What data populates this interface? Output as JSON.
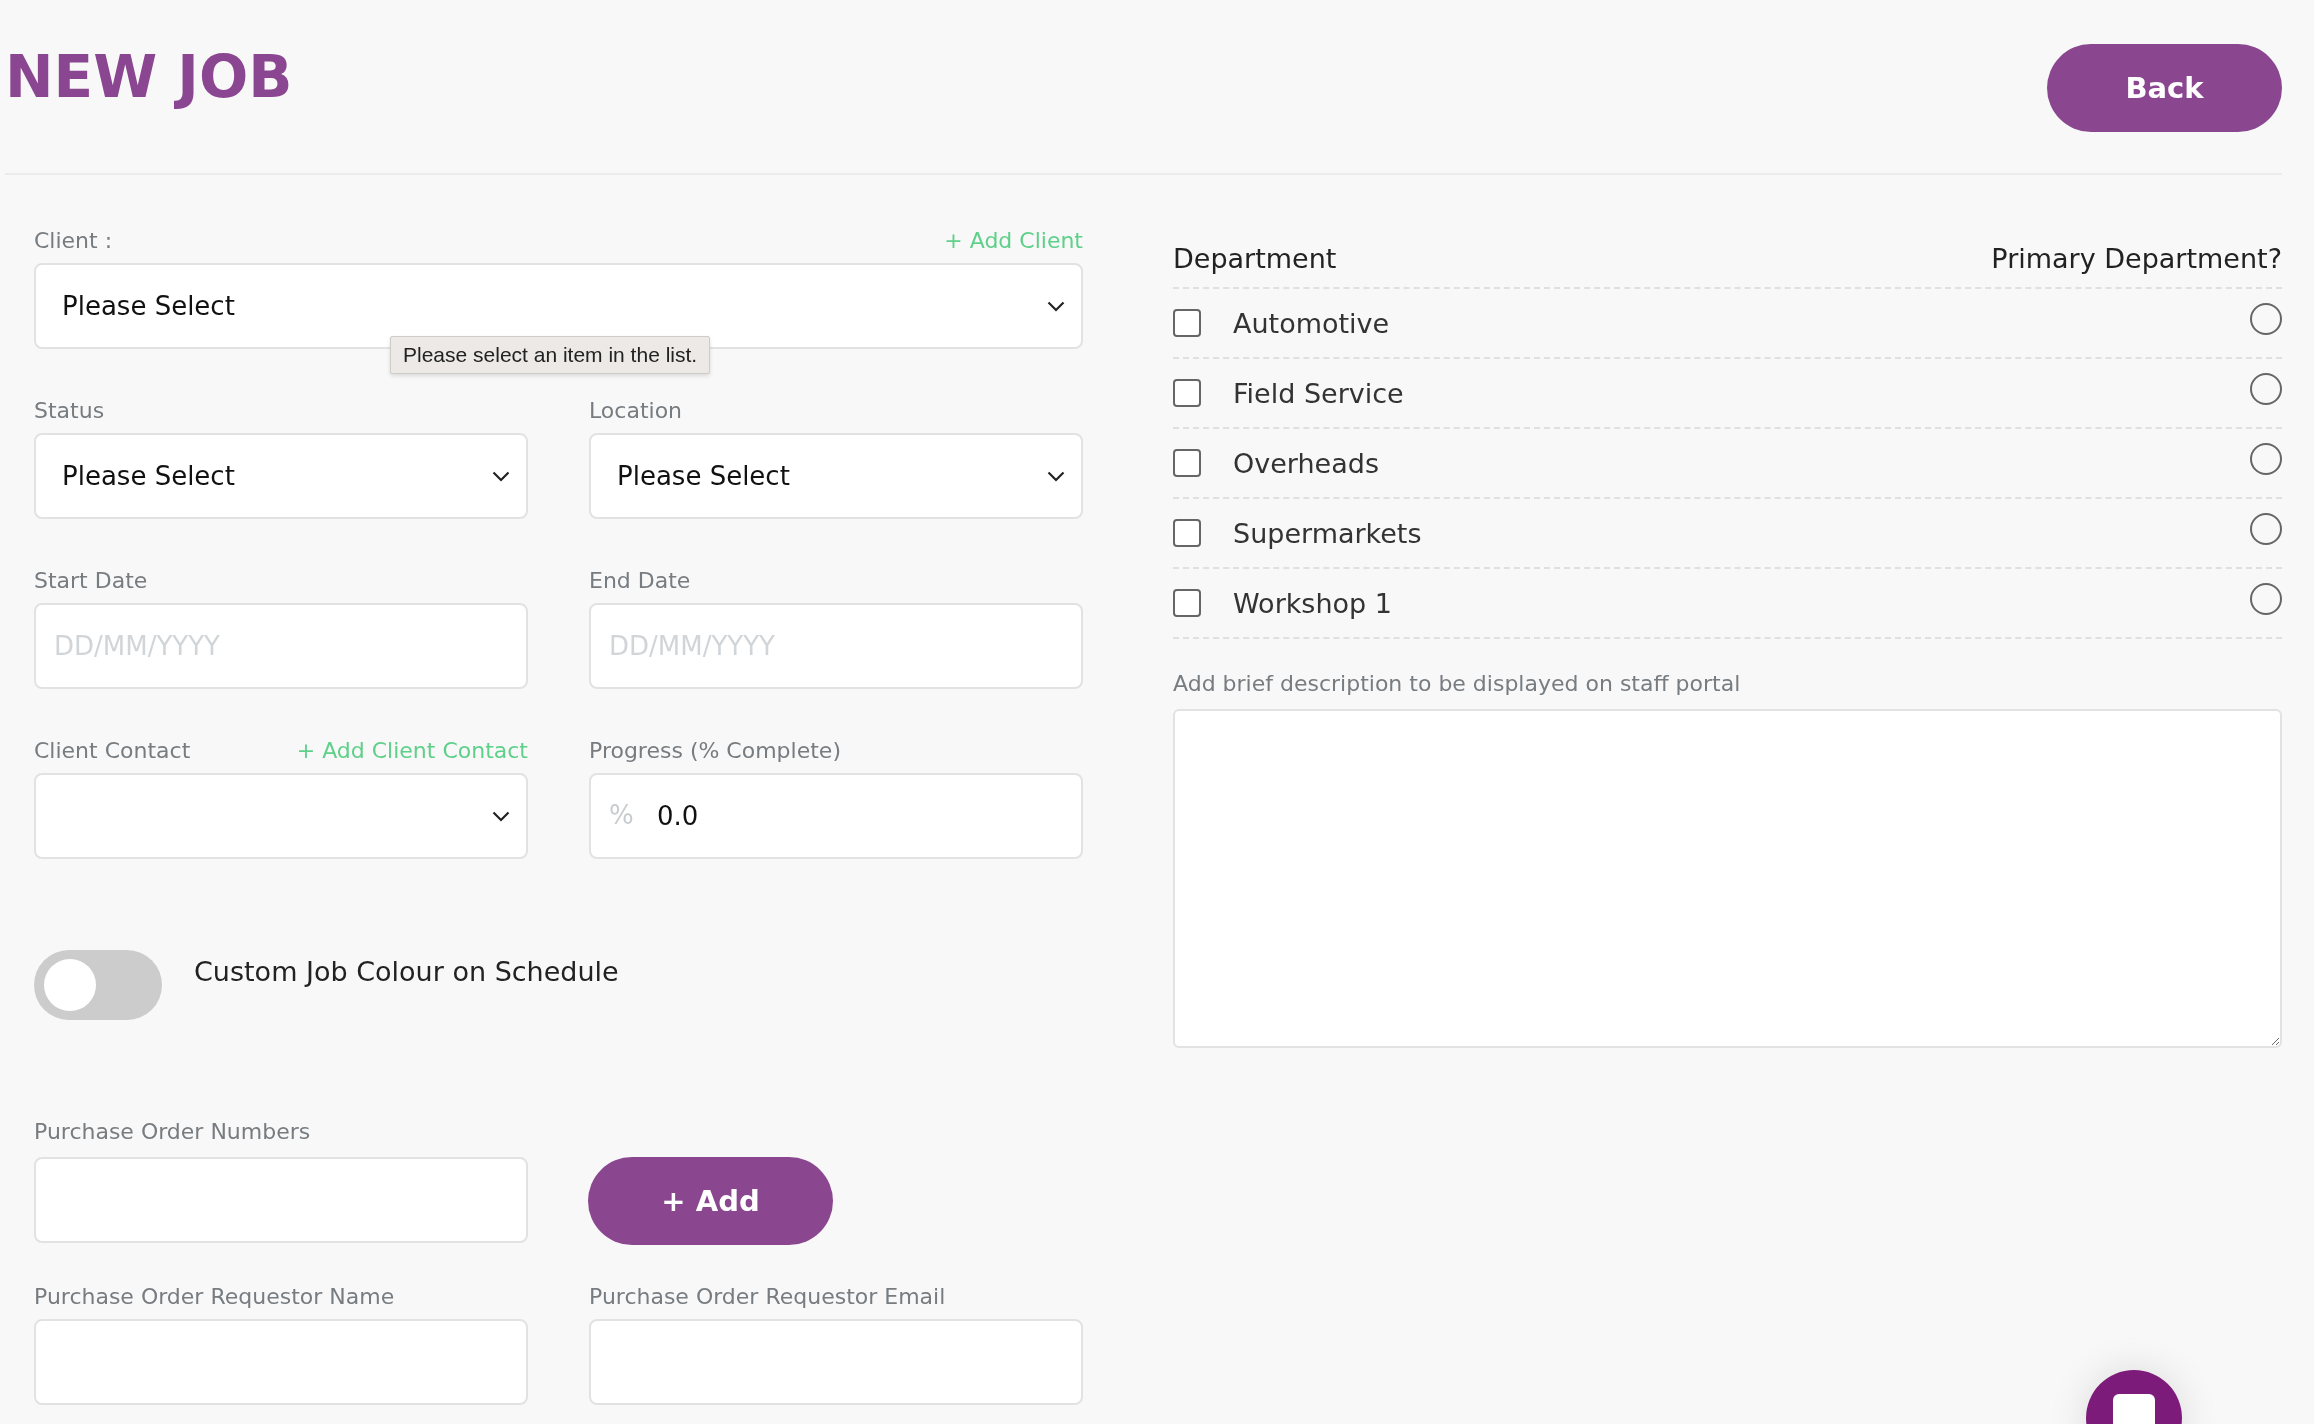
{
  "page": {
    "title": "NEW JOB",
    "back_button": "Back"
  },
  "client": {
    "label": "Client :",
    "add_link": "+ Add Client",
    "value": "Please Select",
    "tooltip": "Please select an item in the list."
  },
  "status": {
    "label": "Status",
    "value": "Please Select"
  },
  "location": {
    "label": "Location",
    "value": "Please Select"
  },
  "start_date": {
    "label": "Start Date",
    "placeholder": "DD/MM/YYYY"
  },
  "end_date": {
    "label": "End Date",
    "placeholder": "DD/MM/YYYY"
  },
  "client_contact": {
    "label": "Client Contact",
    "add_link": "+ Add Client Contact"
  },
  "progress": {
    "label": "Progress (% Complete)",
    "prefix": "%",
    "value": "0.0"
  },
  "custom_colour": {
    "label": "Custom Job Colour on Schedule",
    "on": false
  },
  "purchase_order_numbers": {
    "label": "Purchase Order Numbers",
    "add_button": "+ Add"
  },
  "requestor_name": {
    "label": "Purchase Order Requestor Name"
  },
  "requestor_email": {
    "label": "Purchase Order Requestor Email"
  },
  "departments": {
    "column_1": "Department",
    "column_2": "Primary Department?",
    "items": [
      {
        "name": "Automotive",
        "checked": false,
        "selected": false
      },
      {
        "name": "Field Service",
        "checked": false,
        "selected": false
      },
      {
        "name": "Overheads",
        "checked": false,
        "selected": false
      },
      {
        "name": "Supermarkets",
        "checked": false,
        "selected": false
      },
      {
        "name": "Workshop 1",
        "checked": false,
        "selected": false
      }
    ]
  },
  "description": {
    "label": "Add brief description to be displayed on staff portal"
  }
}
